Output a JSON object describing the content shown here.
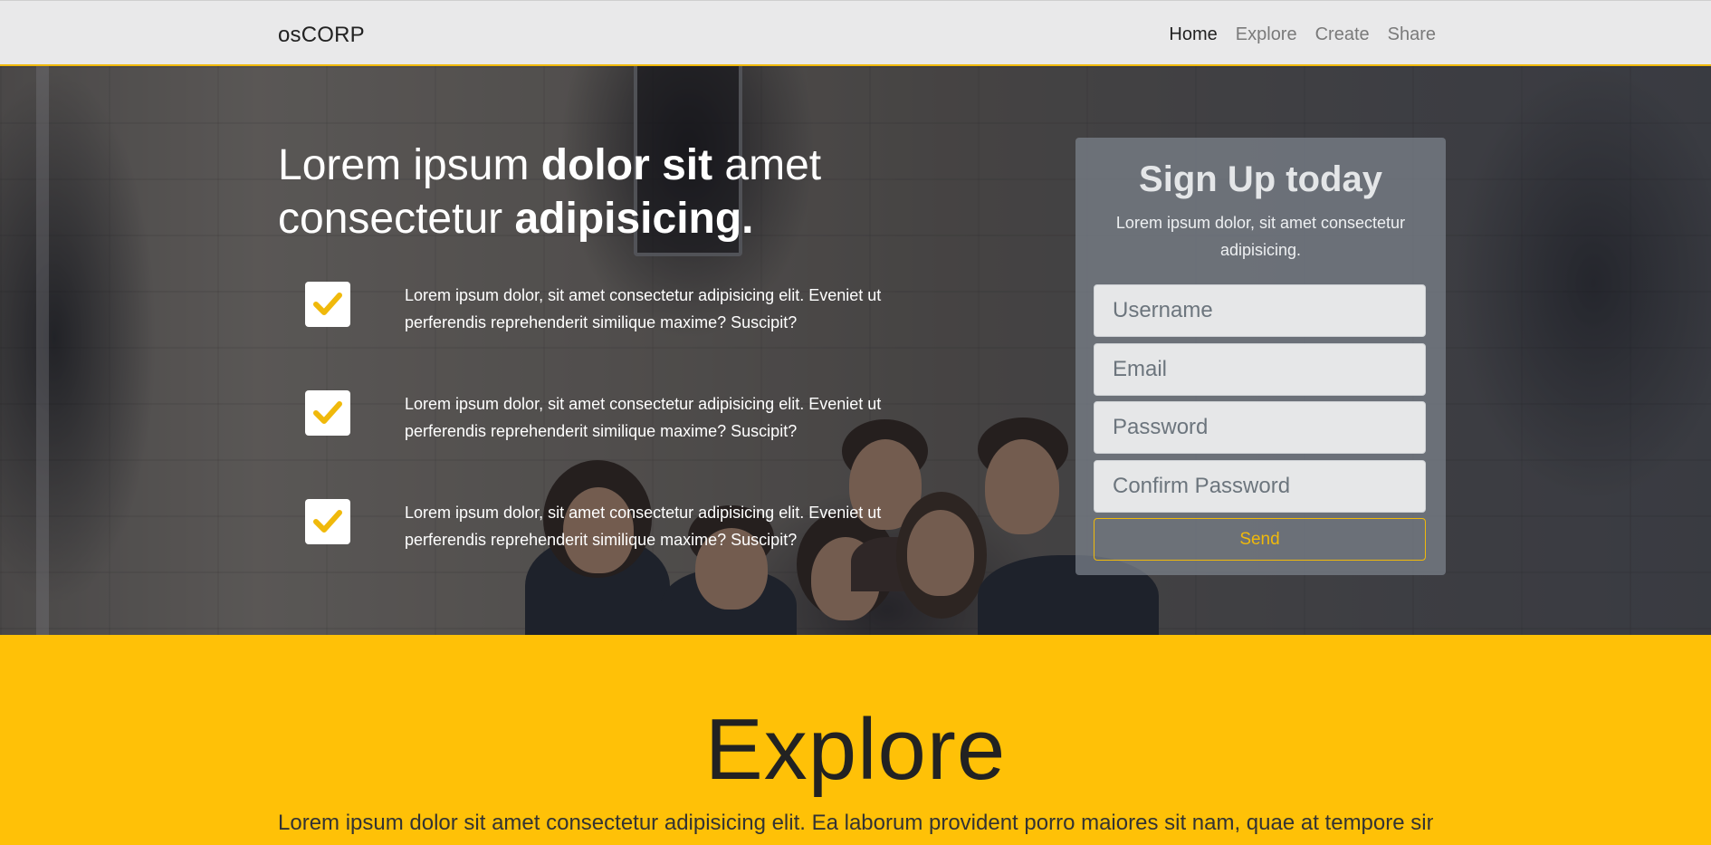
{
  "navbar": {
    "brand": "osCORP",
    "links": [
      "Home",
      "Explore",
      "Create",
      "Share"
    ],
    "active": "Home"
  },
  "hero": {
    "title_parts": [
      "Lorem ipsum ",
      "dolor sit",
      " amet consectetur ",
      "adipisicing."
    ],
    "features": [
      "Lorem ipsum dolor, sit amet consectetur adipisicing elit. Eveniet ut perferendis reprehenderit similique maxime? Suscipit?",
      "Lorem ipsum dolor, sit amet consectetur adipisicing elit. Eveniet ut perferendis reprehenderit similique maxime? Suscipit?",
      "Lorem ipsum dolor, sit amet consectetur adipisicing elit. Eveniet ut perferendis reprehenderit similique maxime? Suscipit?"
    ],
    "check_icon": "check-icon"
  },
  "signup": {
    "title": "Sign Up today",
    "subtitle": "Lorem ipsum dolor, sit amet consectetur adipisicing.",
    "username_placeholder": "Username",
    "email_placeholder": "Email",
    "password_placeholder": "Password",
    "confirm_placeholder": "Confirm Password",
    "send_label": "Send"
  },
  "explore": {
    "heading": "Explore",
    "text": "Lorem ipsum dolor sit amet consectetur adipisicing elit. Ea laborum provident porro maiores sit nam, quae at tempore sint"
  },
  "colors": {
    "accent": "#ffc107",
    "check": "#f0b90b",
    "navbar_bg": "#e9e9ea"
  }
}
